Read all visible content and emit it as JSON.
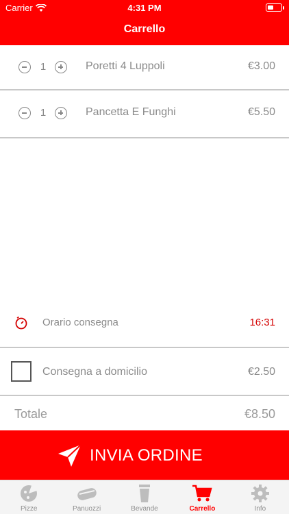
{
  "status_bar": {
    "carrier": "Carrier",
    "time": "4:31 PM"
  },
  "header": {
    "title": "Carrello"
  },
  "cart_items": [
    {
      "quantity": "1",
      "name": "Poretti 4 Luppoli",
      "price": "€3.00"
    },
    {
      "quantity": "1",
      "name": "Pancetta E Funghi",
      "price": "€5.50"
    }
  ],
  "delivery_time": {
    "label": "Orario consegna",
    "value": "16:31",
    "icon": "timer-icon"
  },
  "home_delivery": {
    "label": "Consegna a domicilio",
    "price": "€2.50",
    "checked": false
  },
  "total": {
    "label": "Totale",
    "value": "€8.50"
  },
  "submit": {
    "label": "INVIA ORDINE",
    "icon": "paper-plane-icon"
  },
  "tabs": [
    {
      "label": "Pizze",
      "icon": "pizza-icon",
      "active": false
    },
    {
      "label": "Panuozzi",
      "icon": "sandwich-icon",
      "active": false
    },
    {
      "label": "Bevande",
      "icon": "cup-icon",
      "active": false
    },
    {
      "label": "Carrello",
      "icon": "cart-icon",
      "active": true
    },
    {
      "label": "Info",
      "icon": "gear-icon",
      "active": false
    }
  ],
  "colors": {
    "accent": "#ff0000",
    "time_value": "#d40000",
    "text_muted": "#8a8a8a"
  }
}
